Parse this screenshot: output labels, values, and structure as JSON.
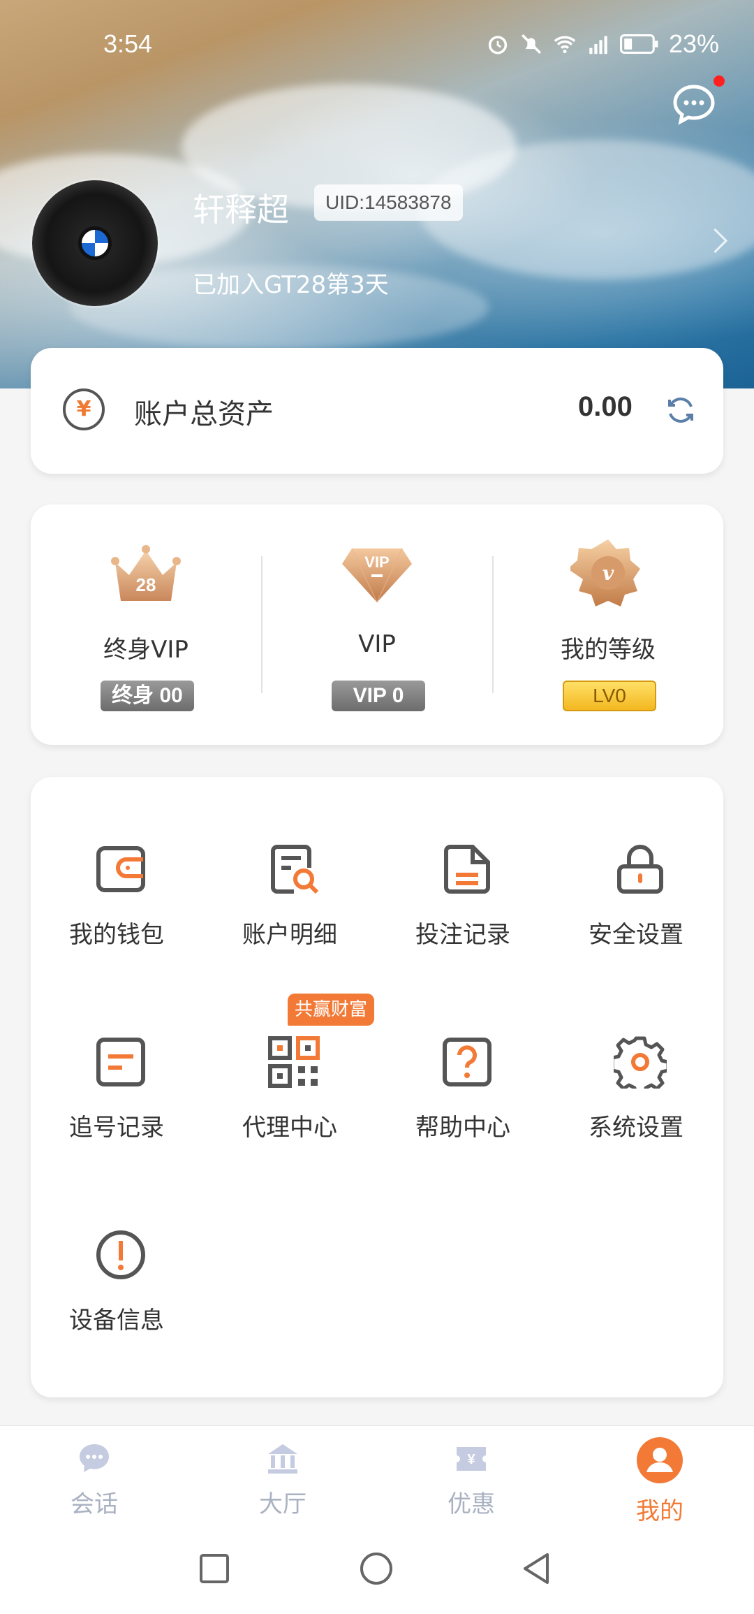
{
  "status_bar": {
    "time": "3:54",
    "battery": "23%"
  },
  "profile": {
    "name": "轩释超",
    "uid": "UID:14583878",
    "joined": "已加入GT28第3天"
  },
  "assets": {
    "label": "账户总资产",
    "value": "0.00",
    "currency_icon": "yen-icon"
  },
  "vip": [
    {
      "label": "终身VIP",
      "tag": "终身 00",
      "icon": "crown-28-icon"
    },
    {
      "label": "VIP",
      "tag": "VIP 0",
      "icon": "vip-diamond-icon"
    },
    {
      "label": "我的等级",
      "tag": "LV0",
      "icon": "level-star-icon"
    }
  ],
  "menu": [
    {
      "label": "我的钱包",
      "icon": "wallet-icon"
    },
    {
      "label": "账户明细",
      "icon": "account-detail-icon"
    },
    {
      "label": "投注记录",
      "icon": "bet-record-icon"
    },
    {
      "label": "安全设置",
      "icon": "lock-icon"
    },
    {
      "label": "追号记录",
      "icon": "chase-record-icon"
    },
    {
      "label": "代理中心",
      "icon": "qr-code-icon",
      "badge": "共赢财富"
    },
    {
      "label": "帮助中心",
      "icon": "help-icon"
    },
    {
      "label": "系统设置",
      "icon": "gear-icon"
    },
    {
      "label": "设备信息",
      "icon": "info-icon"
    }
  ],
  "tabs": [
    {
      "label": "会话",
      "icon": "chat-icon",
      "active": false
    },
    {
      "label": "大厅",
      "icon": "hall-icon",
      "active": false
    },
    {
      "label": "优惠",
      "icon": "coupon-icon",
      "active": false
    },
    {
      "label": "我的",
      "icon": "user-icon",
      "active": true
    }
  ],
  "colors": {
    "accent": "#f27a36",
    "tab_inactive": "#aab2c2",
    "badge": "#f27a36"
  }
}
